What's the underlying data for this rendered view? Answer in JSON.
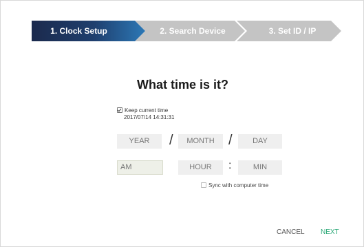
{
  "steps": [
    {
      "label": "1. Clock Setup",
      "active": true
    },
    {
      "label": "2. Search Device",
      "active": false
    },
    {
      "label": "3. Set ID / IP",
      "active": false
    }
  ],
  "heading": "What time is it?",
  "keep_current": {
    "label": "Keep current time",
    "checked": true,
    "current_time": "2017/07/14 14:31:31"
  },
  "date": {
    "year_placeholder": "YEAR",
    "month_placeholder": "MONTH",
    "day_placeholder": "DAY",
    "separator": "/"
  },
  "time": {
    "ampm_value": "AM",
    "hour_placeholder": "HOUR",
    "minute_placeholder": "MIN",
    "separator": ":"
  },
  "sync": {
    "label": "Sync with computer time",
    "checked": false
  },
  "footer": {
    "cancel_label": "CANCEL",
    "next_label": "NEXT"
  },
  "colors": {
    "active_step": "#1f3f6e",
    "inactive_step": "#c4c4c4",
    "next_button": "#2aa876"
  }
}
